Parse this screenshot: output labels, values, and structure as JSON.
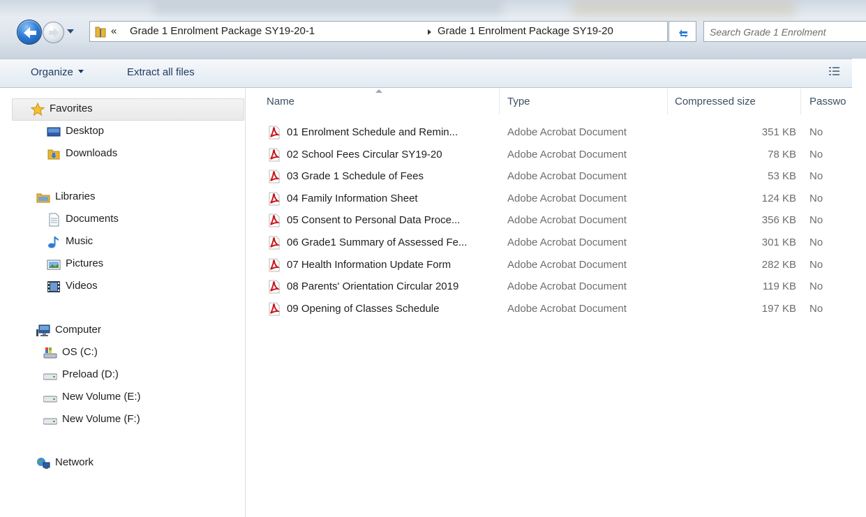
{
  "address_bar": {
    "crumb_prefix": "«",
    "crumbs": [
      "Grade 1 Enrolment Package SY19-20-1",
      "Grade 1 Enrolment Package SY19-20"
    ],
    "search_placeholder": "Search Grade 1 Enrolment"
  },
  "toolbar": {
    "organize_label": "Organize",
    "extract_label": "Extract all files"
  },
  "sidebar": {
    "favorites": {
      "label": "Favorites",
      "items": [
        "Desktop",
        "Downloads"
      ]
    },
    "libraries": {
      "label": "Libraries",
      "items": [
        "Documents",
        "Music",
        "Pictures",
        "Videos"
      ]
    },
    "computer": {
      "label": "Computer",
      "items": [
        "OS (C:)",
        "Preload (D:)",
        "New Volume (E:)",
        "New Volume (F:)"
      ]
    },
    "network": {
      "label": "Network"
    }
  },
  "file_list": {
    "columns": [
      "Name",
      "Type",
      "Compressed size",
      "Passwo"
    ],
    "rows": [
      {
        "name": "01 Enrolment Schedule and Remin...",
        "type": "Adobe Acrobat Document",
        "size": "351 KB",
        "password": "No"
      },
      {
        "name": "02 School Fees Circular SY19-20",
        "type": "Adobe Acrobat Document",
        "size": "78 KB",
        "password": "No"
      },
      {
        "name": "03 Grade 1 Schedule of Fees",
        "type": "Adobe Acrobat Document",
        "size": "53 KB",
        "password": "No"
      },
      {
        "name": "04 Family Information Sheet",
        "type": "Adobe Acrobat Document",
        "size": "124 KB",
        "password": "No"
      },
      {
        "name": "05 Consent to Personal Data Proce...",
        "type": "Adobe Acrobat Document",
        "size": "356 KB",
        "password": "No"
      },
      {
        "name": "06 Grade1 Summary of Assessed Fe...",
        "type": "Adobe Acrobat Document",
        "size": "301 KB",
        "password": "No"
      },
      {
        "name": "07 Health Information Update Form",
        "type": "Adobe Acrobat Document",
        "size": "282 KB",
        "password": "No"
      },
      {
        "name": "08 Parents' Orientation Circular 2019",
        "type": "Adobe Acrobat Document",
        "size": "119 KB",
        "password": "No"
      },
      {
        "name": "09 Opening of Classes Schedule",
        "type": "Adobe Acrobat Document",
        "size": "197 KB",
        "password": "No"
      }
    ]
  },
  "colors": {
    "accent_blue": "#2f7dd6",
    "pdf_red": "#c8191e",
    "folder_yellow": "#e8b533",
    "selection_grey": "#eeeeee"
  }
}
